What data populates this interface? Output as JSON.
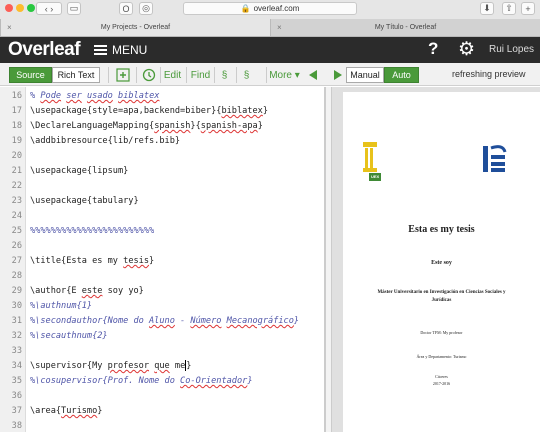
{
  "browser": {
    "url": "overleaf.com",
    "tabs": [
      {
        "title": "My Projects - Overleaf",
        "active": false
      },
      {
        "title": "My Título - Overleaf",
        "active": true
      }
    ]
  },
  "header": {
    "logo": "Overleaf",
    "menu_label": "MENU",
    "help_symbol": "?",
    "gear_symbol": "⚙",
    "user": "Rui Lopes"
  },
  "toolbar": {
    "source_label": "Source",
    "rich_label": "Rich Text",
    "edit_label": "Edit",
    "find_label": "Find",
    "section_symbol_1": "§",
    "section_symbol_2": "§",
    "more_label": "More",
    "manual_label": "Manual",
    "auto_label": "Auto",
    "refreshing_label": "refreshing preview"
  },
  "editor": {
    "lines": [
      {
        "n": "16",
        "t": "% Pode ser usado biblatex",
        "c": true
      },
      {
        "n": "17",
        "t": "\\usepackage{style=apa,backend=biber}{biblatex}",
        "c": false
      },
      {
        "n": "18",
        "t": "\\DeclareLanguageMapping{spanish}{spanish-apa}",
        "c": false
      },
      {
        "n": "19",
        "t": "\\addbibresource{lib/refs.bib}",
        "c": false
      },
      {
        "n": "20",
        "t": "",
        "c": false
      },
      {
        "n": "21",
        "t": "\\usepackage{lipsum}",
        "c": false
      },
      {
        "n": "22",
        "t": "",
        "c": false
      },
      {
        "n": "23",
        "t": "\\usepackage{tabulary}",
        "c": false
      },
      {
        "n": "24",
        "t": "",
        "c": false
      },
      {
        "n": "25",
        "t": "%%%%%%%%%%%%%%%%%%%%%%%%",
        "c": true
      },
      {
        "n": "26",
        "t": "",
        "c": false
      },
      {
        "n": "27",
        "t": "\\title{Esta es my tesis}",
        "c": false
      },
      {
        "n": "28",
        "t": "",
        "c": false
      },
      {
        "n": "29",
        "t": "\\author{E este soy yo}",
        "c": false
      },
      {
        "n": "30",
        "t": "%\\authnum{1}",
        "c": true
      },
      {
        "n": "31",
        "t": "%\\secondauthor{Nome do Aluno - Número Mecanográfico}",
        "c": true
      },
      {
        "n": "32",
        "t": "%\\secauthnum{2}",
        "c": true
      },
      {
        "n": "33",
        "t": "",
        "c": false
      },
      {
        "n": "34",
        "t": "\\supervisor{My profesor que me}",
        "c": false
      },
      {
        "n": "35",
        "t": "%\\cosupervisor{Prof. Nome do Co-Orientador}",
        "c": true
      },
      {
        "n": "36",
        "t": "",
        "c": false
      },
      {
        "n": "37",
        "t": "\\area{Turismo}",
        "c": false
      },
      {
        "n": "38",
        "t": "",
        "c": false
      }
    ]
  },
  "preview": {
    "logo_letters": "UEX",
    "title": "Esta es my tesis",
    "author": "Este soy",
    "degree_1": "Máster Universitario en Investigación en Ciencias Sociales y",
    "degree_2": "Jurídicas",
    "supervisor": "Doctor TFM: My profesor",
    "area": "Área y Departamento: Turismo",
    "city": "Cáceres",
    "date": "2017-2016"
  },
  "colors": {
    "accent": "#4a9a3a",
    "header": "#2b2b2b",
    "comment": "#4f55a8",
    "logo_blue": "#1f4e9a",
    "logo_yellow": "#e8c21b"
  }
}
